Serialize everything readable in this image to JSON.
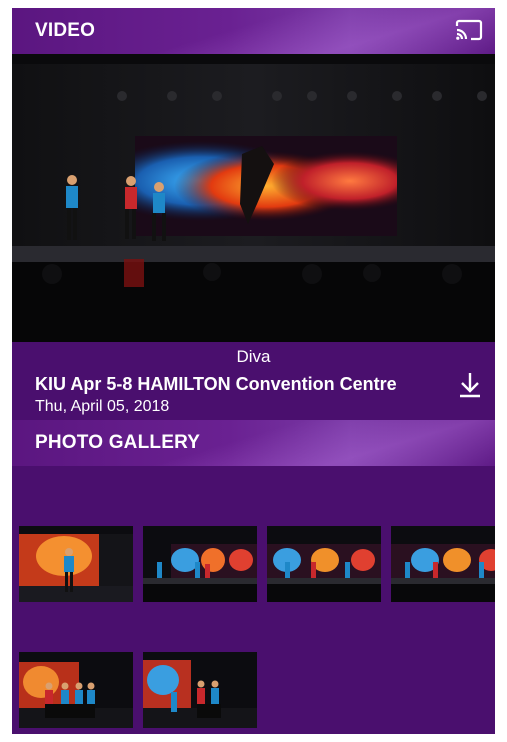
{
  "video_section": {
    "title": "VIDEO",
    "cast_icon": "cast-icon"
  },
  "video": {
    "subtitle": "Diva",
    "title": "KIU Apr 5-8  HAMILTON Convention Centre",
    "date": "Thu, April 05, 2018",
    "download_icon": "download-icon"
  },
  "photo_gallery": {
    "title": "PHOTO GALLERY",
    "photos": [
      {
        "name": "photo-1"
      },
      {
        "name": "photo-2"
      },
      {
        "name": "photo-3"
      },
      {
        "name": "photo-4"
      },
      {
        "name": "photo-5"
      },
      {
        "name": "photo-6"
      }
    ]
  },
  "colors": {
    "background": "#4a0f6e",
    "header": "#5b1680",
    "text": "#ffffff"
  }
}
